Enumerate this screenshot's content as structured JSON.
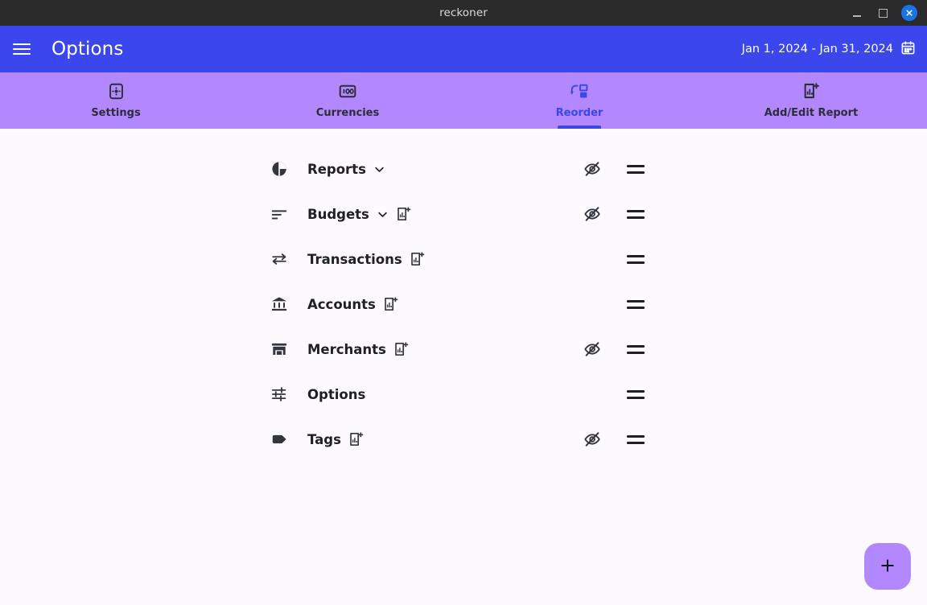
{
  "window": {
    "title": "reckoner",
    "controls": {
      "minimize_label": "minimize",
      "maximize_label": "maximize",
      "close_label": "×"
    }
  },
  "appbar": {
    "menu_label": "menu",
    "title": "Options",
    "date_range": "Jan 1, 2024 - Jan 31, 2024",
    "calendar_icon": "calendar-icon",
    "background": "#3b46ec"
  },
  "tabs": {
    "background": "#b388ff",
    "active_color": "#3b46ec",
    "items": [
      {
        "label": "Settings",
        "icon": "settings-gear-icon",
        "active": false
      },
      {
        "label": "Currencies",
        "icon": "banknote-100-icon",
        "active": false
      },
      {
        "label": "Reorder",
        "icon": "reorder-icon",
        "active": true
      },
      {
        "label": "Add/Edit Report",
        "icon": "add-report-icon",
        "active": false
      }
    ]
  },
  "content": {
    "background": "#fdfaff",
    "rows": [
      {
        "label": "Reports",
        "icon": "pie-chart-icon",
        "has_chevron": true,
        "has_add_report": false,
        "hidden_toggle": true,
        "drag_handle": true
      },
      {
        "label": "Budgets",
        "icon": "sort-bars-icon",
        "has_chevron": true,
        "has_add_report": true,
        "hidden_toggle": true,
        "drag_handle": true
      },
      {
        "label": "Transactions",
        "icon": "transfer-icon",
        "has_chevron": false,
        "has_add_report": true,
        "hidden_toggle": false,
        "drag_handle": true
      },
      {
        "label": "Accounts",
        "icon": "bank-icon",
        "has_chevron": false,
        "has_add_report": true,
        "hidden_toggle": false,
        "drag_handle": true
      },
      {
        "label": "Merchants",
        "icon": "storefront-icon",
        "has_chevron": false,
        "has_add_report": true,
        "hidden_toggle": true,
        "drag_handle": true
      },
      {
        "label": "Options",
        "icon": "tune-sliders-icon",
        "has_chevron": false,
        "has_add_report": false,
        "hidden_toggle": false,
        "drag_handle": true
      },
      {
        "label": "Tags",
        "icon": "tag-icon",
        "has_chevron": false,
        "has_add_report": true,
        "hidden_toggle": true,
        "drag_handle": true
      }
    ],
    "eye_off_icon": "eye-off-icon",
    "drag_handle_icon": "drag-handle-icon"
  },
  "fab": {
    "label": "+",
    "icon": "plus-icon",
    "background": "#b388ff"
  }
}
